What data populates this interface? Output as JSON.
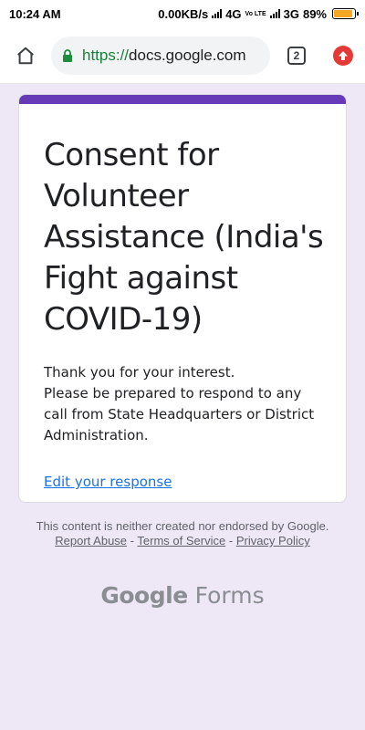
{
  "status_bar": {
    "time": "10:24 AM",
    "network_speed": "0.00KB/s",
    "network_1": "4G",
    "volte_label": "Vo LTE",
    "network_2": "3G",
    "battery": "89%",
    "battery_level": 0.89
  },
  "browser": {
    "url_scheme": "https://",
    "url_host": "docs.google.com",
    "tab_count": "2",
    "accent_lock": "#1e8e3e",
    "update_color": "#e53935"
  },
  "form": {
    "title": "Consent for Volunteer Assistance (India's Fight against COVID-19)",
    "confirmation": "Thank you for your interest.\nPlease be prepared to respond to any call from State Headquarters or District Administration.",
    "edit_link": "Edit your response",
    "accent_color": "#673ab7"
  },
  "footer": {
    "disclaimer": "This content is neither created nor endorsed by Google.",
    "report_abuse": "Report Abuse",
    "separator": "-",
    "terms": "Terms of Service",
    "privacy": "Privacy Policy"
  },
  "brand": {
    "google": "Google",
    "forms": "Forms"
  }
}
